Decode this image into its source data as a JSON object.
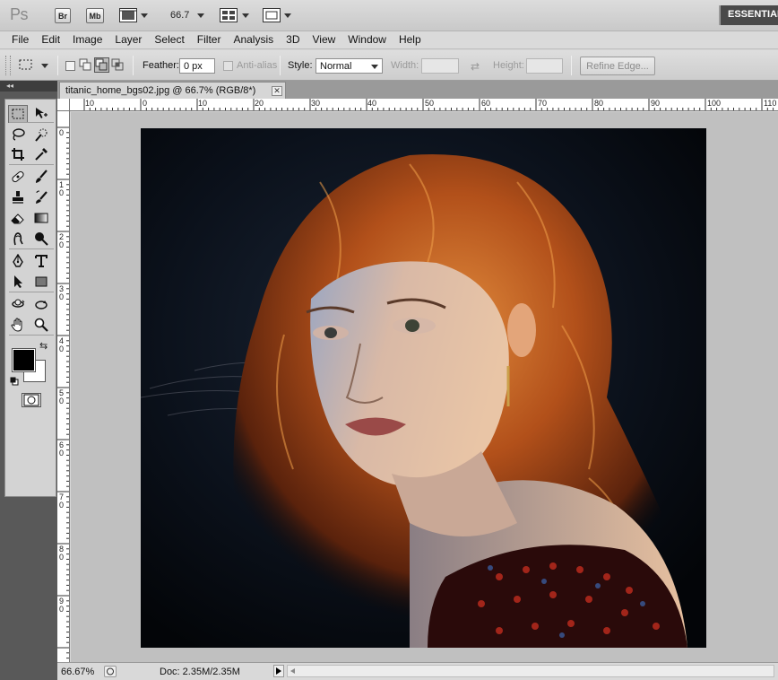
{
  "app": {
    "logo": "Ps",
    "bridge_label": "Br",
    "minibridge_label": "Mb",
    "zoom_value": "66.7",
    "workspace_label": "ESSENTIALS"
  },
  "menu": [
    "File",
    "Edit",
    "Image",
    "Layer",
    "Select",
    "Filter",
    "Analysis",
    "3D",
    "View",
    "Window",
    "Help"
  ],
  "options": {
    "feather_label": "Feather:",
    "feather_value": "0 px",
    "antialias_label": "Anti-alias",
    "style_label": "Style:",
    "style_value": "Normal",
    "width_label": "Width:",
    "height_label": "Height:",
    "refine_edge_label": "Refine Edge..."
  },
  "panel": {
    "collapse_glyph": "◂◂"
  },
  "document": {
    "tab_title": "titanic_home_bgs02.jpg @ 66.7% (RGB/8*)",
    "close_glyph": "✕"
  },
  "ruler": {
    "top_labels": [
      "10",
      "0",
      "10",
      "20",
      "30",
      "40",
      "50",
      "60",
      "70",
      "80",
      "90",
      "100",
      "110"
    ],
    "left_labels": [
      "0",
      "1\n0",
      "2\n0",
      "3\n0",
      "4\n0",
      "5\n0",
      "6\n0",
      "7\n0",
      "8\n0",
      "9\n0"
    ]
  },
  "status": {
    "zoom": "66.67%",
    "doc_info": "Doc: 2.35M/2.35M"
  },
  "colors": {
    "foreground": "#000000",
    "background": "#ffffff",
    "workspace_btn": "#4a4a4a"
  },
  "image": {
    "subject_palette": [
      "#b3511a",
      "#d9804a",
      "#e8c3a8",
      "#0a0f18"
    ]
  }
}
